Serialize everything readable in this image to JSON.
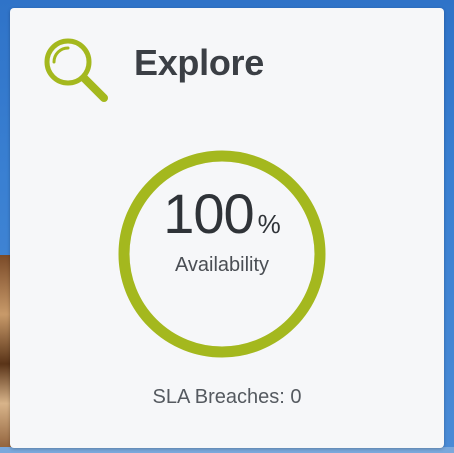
{
  "card": {
    "title": "Explore",
    "icon": "search-icon",
    "accent_color": "#a4b81e"
  },
  "gauge": {
    "value": "100",
    "unit": "%",
    "label": "Availability",
    "fraction": 1.0
  },
  "footer": {
    "sla_breaches": "SLA Breaches: 0"
  }
}
